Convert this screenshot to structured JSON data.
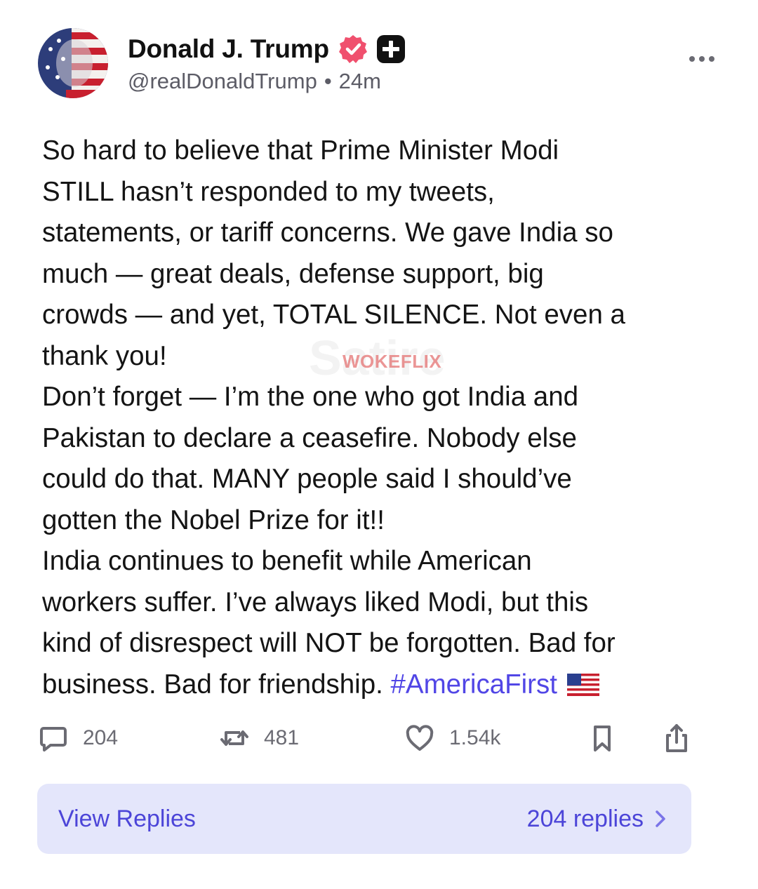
{
  "author": {
    "display_name": "Donald J. Trump",
    "handle": "@realDonaldTrump",
    "separator": "•",
    "time_ago": "24m",
    "verified_icon": "verified-badge-icon",
    "badge_icon": "plus-badge-icon"
  },
  "post": {
    "lines": [
      "So hard to believe that Prime Minister Modi",
      "STILL hasn’t responded to my tweets,",
      "statements, or tariff concerns. We gave India so",
      "much — great deals, defense support, big",
      "crowds — and yet, TOTAL SILENCE. Not even a",
      "thank you!",
      "Don’t forget — I’m the one who got India and",
      "Pakistan to declare a ceasefire. Nobody else",
      "could do that. MANY people said I should’ve",
      "gotten the Nobel Prize for it!!",
      "India continues to benefit while American",
      "workers suffer. I’ve always liked Modi, but this",
      "kind of disrespect will NOT be forgotten. Bad for"
    ],
    "last_line_text": "business. Bad for friendship. ",
    "hashtag": "#AmericaFirst",
    "flag_icon": "us-flag-icon"
  },
  "watermark": {
    "text": "WOKEFLIX",
    "background_text": "Satire"
  },
  "actions": {
    "replies_count": "204",
    "reposts_count": "481",
    "likes_count": "1.54k"
  },
  "view_replies": {
    "label": "View Replies",
    "count_label": "204 replies"
  },
  "colors": {
    "accent": "#5146e6",
    "verified": "#f0506e",
    "replies_bg": "#e4e6fb",
    "muted": "#6b6b73"
  }
}
